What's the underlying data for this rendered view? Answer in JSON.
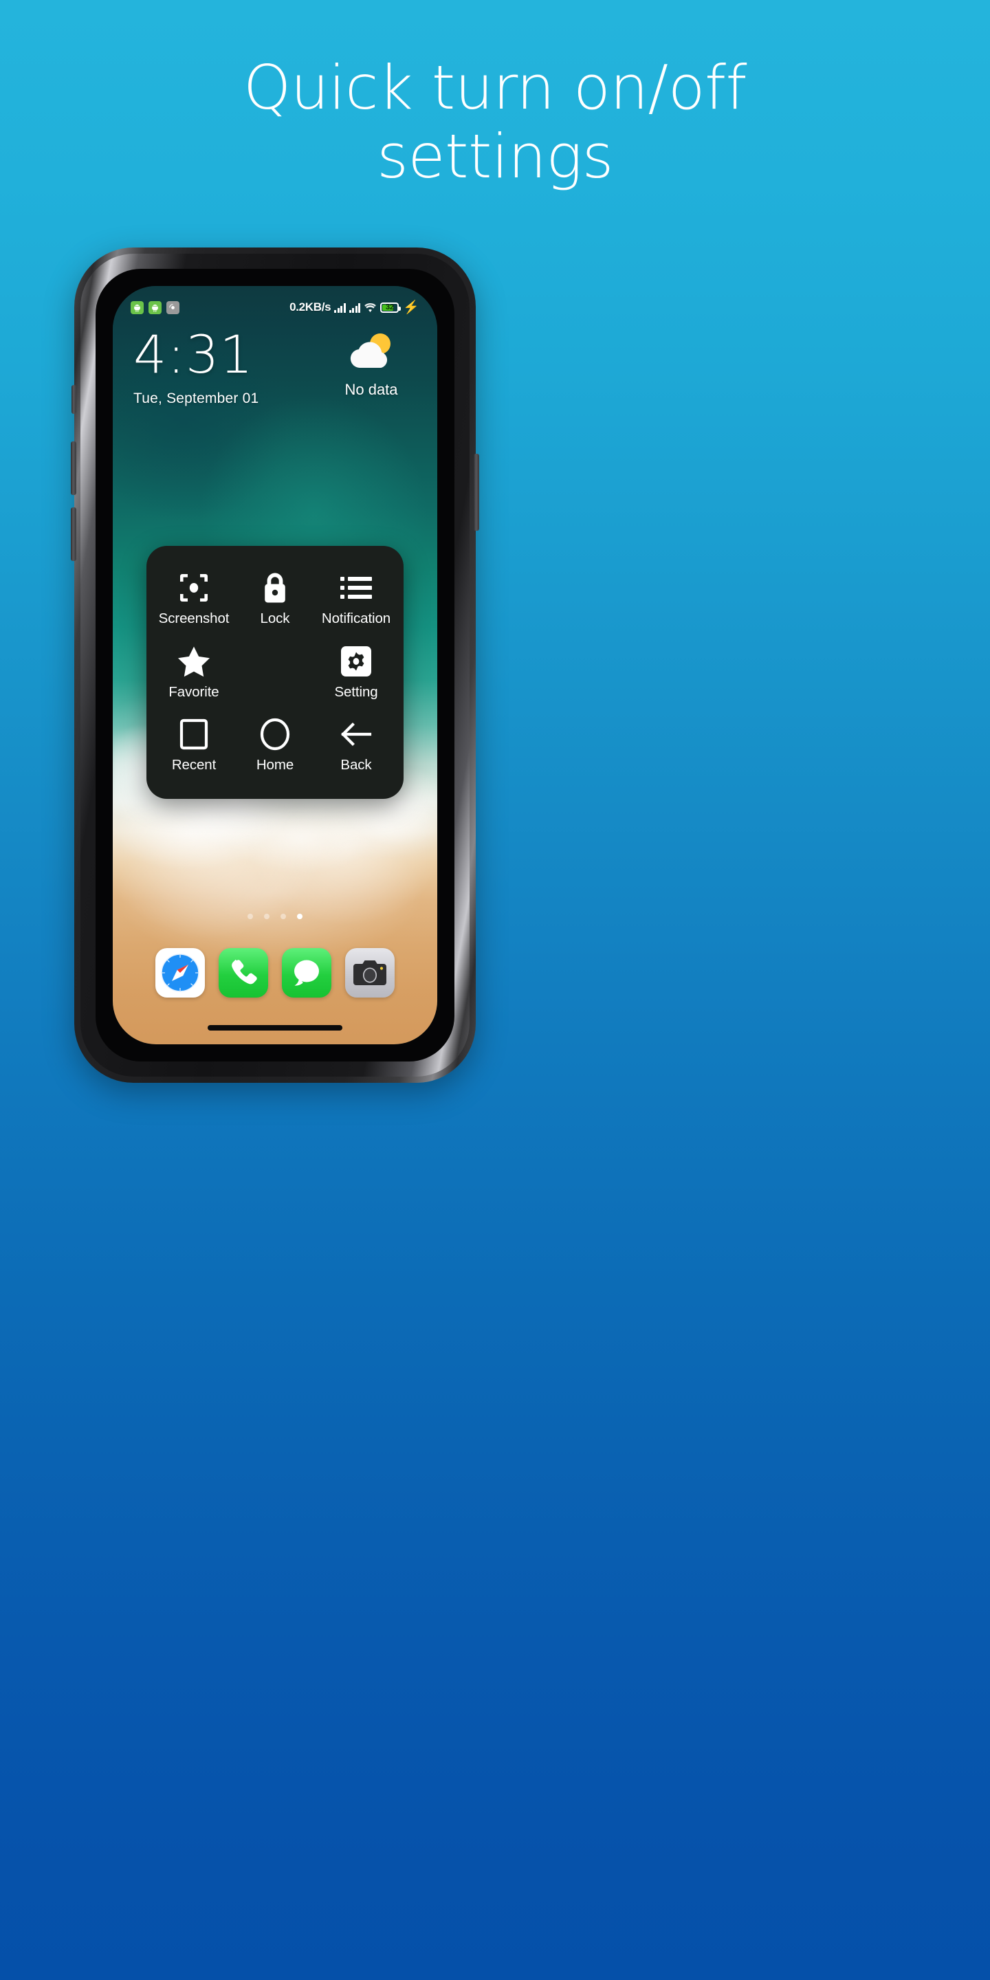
{
  "promo": {
    "headline_line1": "Quick turn on/off",
    "headline_line2": "settings",
    "bg_top_color": "#24b4dc",
    "bg_bottom_color": "#0550a9"
  },
  "phone": {
    "status_bar": {
      "left_icons": [
        {
          "name": "android-app-badge-icon",
          "color": "#6bc349"
        },
        {
          "name": "android-app-badge-icon",
          "color": "#6bc349"
        },
        {
          "name": "touch-gesture-icon",
          "color": "#9a9a9a"
        }
      ],
      "network_speed": "0.2KB/s",
      "signal_1": "signal-bars-icon",
      "signal_2": "signal-bars-icon",
      "wifi": "wifi-icon",
      "battery_level": "32",
      "battery_color": "#46c11a",
      "charging": "charging-bolt-icon"
    },
    "lockscreen": {
      "time": "4:31",
      "date": "Tue, September 01",
      "weather_icon": "sun-behind-cloud-icon",
      "weather_label": "No data"
    },
    "assistive_panel": {
      "background": "#1b1f1c",
      "rows": [
        [
          {
            "icon": "screenshot-icon",
            "label": "Screenshot"
          },
          {
            "icon": "lock-icon",
            "label": "Lock"
          },
          {
            "icon": "notification-icon",
            "label": "Notification"
          }
        ],
        [
          {
            "icon": "star-icon",
            "label": "Favorite"
          },
          {
            "icon": "",
            "label": ""
          },
          {
            "icon": "gear-icon",
            "label": "Setting"
          }
        ],
        [
          {
            "icon": "square-icon",
            "label": "Recent"
          },
          {
            "icon": "circle-icon",
            "label": "Home"
          },
          {
            "icon": "arrow-left-icon",
            "label": "Back"
          }
        ]
      ]
    },
    "page_dots": {
      "total": 4,
      "active_index": 3
    },
    "dock": [
      {
        "name": "safari",
        "icon": "safari-compass-icon"
      },
      {
        "name": "phone",
        "icon": "phone-handset-icon"
      },
      {
        "name": "messages",
        "icon": "message-bubble-icon"
      },
      {
        "name": "camera",
        "icon": "camera-icon"
      }
    ],
    "home_indicator": "home-indicator-bar"
  }
}
